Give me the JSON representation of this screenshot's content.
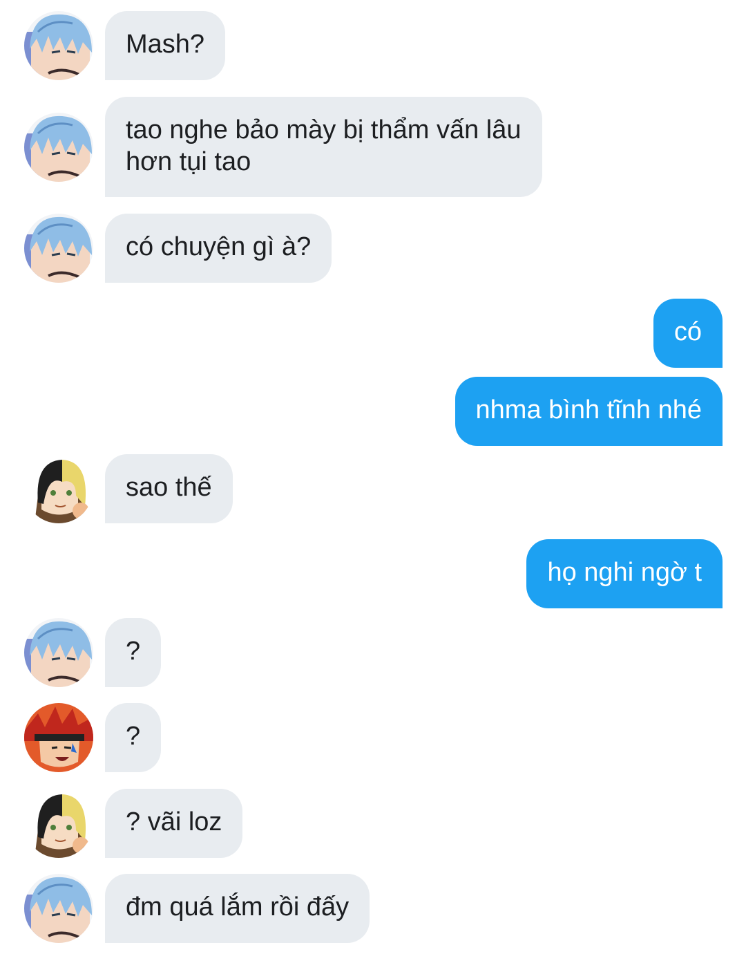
{
  "colors": {
    "background": "#ffffff",
    "incoming_bubble": "#e8ecf0",
    "outgoing_bubble": "#1da1f2",
    "incoming_text": "#1c1e21",
    "outgoing_text": "#ffffff"
  },
  "messages": [
    {
      "direction": "incoming",
      "avatar": "blue-hair-avatar",
      "text": "Mash?"
    },
    {
      "direction": "incoming",
      "avatar": "blue-hair-avatar",
      "text": "tao nghe bảo mày bị thẩm vấn lâu\nhơn tụi tao"
    },
    {
      "direction": "incoming",
      "avatar": "blue-hair-avatar",
      "text": "có chuyện gì à?"
    },
    {
      "direction": "outgoing",
      "text": "có"
    },
    {
      "direction": "outgoing",
      "text": "nhma bình tĩnh nhé"
    },
    {
      "direction": "incoming",
      "avatar": "two-tone-hair-avatar",
      "text": "sao thế"
    },
    {
      "direction": "outgoing",
      "text": "họ nghi ngờ t"
    },
    {
      "direction": "incoming",
      "avatar": "blue-hair-avatar",
      "text": "?"
    },
    {
      "direction": "incoming",
      "avatar": "red-hair-avatar",
      "text": "?"
    },
    {
      "direction": "incoming",
      "avatar": "two-tone-hair-avatar",
      "text": "? vãi loz"
    },
    {
      "direction": "incoming",
      "avatar": "blue-hair-avatar",
      "text": "đm quá lắm rồi đấy"
    }
  ]
}
